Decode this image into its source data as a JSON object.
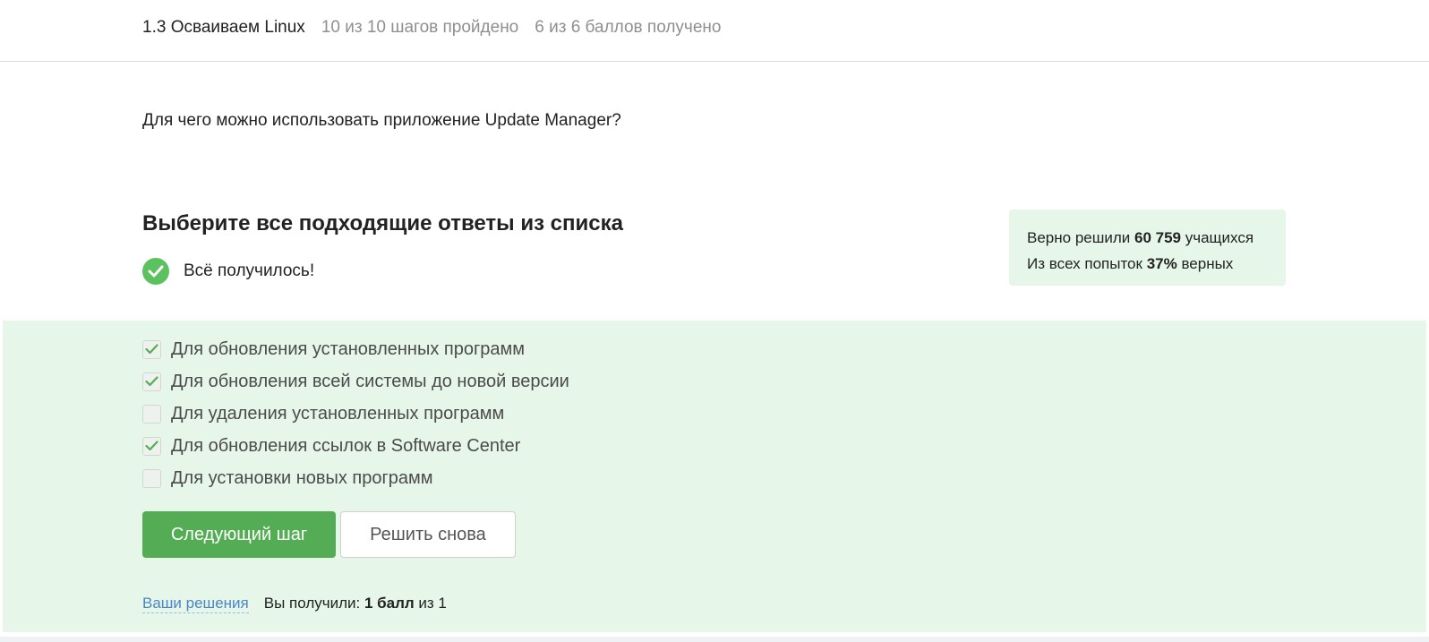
{
  "header": {
    "lesson_title": "1.3 Осваиваем Linux",
    "steps_progress": "10 из 10 шагов пройдено",
    "points_progress": "6 из 6 баллов  получено"
  },
  "step": {
    "question": "Для чего можно использовать приложение Update Manager?",
    "instruction": "Выберите все подходящие ответы из списка",
    "result_text": "Всё получилось!"
  },
  "stats": {
    "solved_prefix": "Верно решили ",
    "solved_count": "60 759",
    "solved_suffix": " учащихся",
    "attempts_prefix": "Из всех попыток ",
    "attempts_percent": "37%",
    "attempts_suffix": " верных"
  },
  "options": [
    {
      "label": "Для обновления установленных программ",
      "checked": true
    },
    {
      "label": "Для обновления всей системы до новой версии",
      "checked": true
    },
    {
      "label": "Для удаления установленных программ",
      "checked": false
    },
    {
      "label": "Для обновления ссылок в Software Center",
      "checked": true
    },
    {
      "label": "Для установки новых программ",
      "checked": false
    }
  ],
  "buttons": {
    "next": "Следующий шаг",
    "retry": "Решить снова"
  },
  "footer": {
    "solutions_link": "Ваши решения",
    "score_prefix": "Вы получили: ",
    "score_value": "1 балл",
    "score_suffix": " из 1"
  },
  "colors": {
    "accent_green": "#54ad54",
    "success_circle": "#5cc15f",
    "answer_background": "#e6f6e8",
    "link_blue": "#4a86c8"
  },
  "icons": {
    "result": "check-circle-icon",
    "option_checked": "checkmark-icon"
  }
}
